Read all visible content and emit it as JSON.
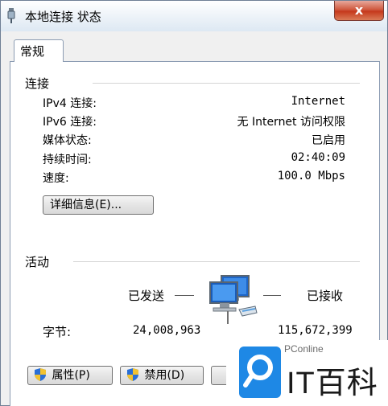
{
  "window": {
    "title": "本地连接 状态",
    "close_glyph": "x"
  },
  "tabs": [
    {
      "label": "常规"
    }
  ],
  "connection": {
    "section_title": "连接",
    "rows": [
      {
        "label": "IPv4 连接:",
        "value": "Internet"
      },
      {
        "label": "IPv6 连接:",
        "value": "无 Internet 访问权限"
      },
      {
        "label": "媒体状态:",
        "value": "已启用"
      },
      {
        "label": "持续时间:",
        "value": "02:40:09"
      },
      {
        "label": "速度:",
        "value": "100.0 Mbps"
      }
    ],
    "details_button": "详细信息(E)..."
  },
  "activity": {
    "section_title": "活动",
    "sent_label": "已发送",
    "received_label": "已接收",
    "bytes_label": "字节:",
    "bytes_sent": "24,008,963",
    "bytes_received": "115,672,399"
  },
  "buttons": {
    "properties": "属性(P)",
    "disable": "禁用(D)"
  },
  "watermark": {
    "small_text": "PConline",
    "big_text": "IT百科"
  },
  "colors": {
    "close_red": "#c5391c",
    "accent_blue": "#1e88e5",
    "border": "#8c9cb3"
  }
}
